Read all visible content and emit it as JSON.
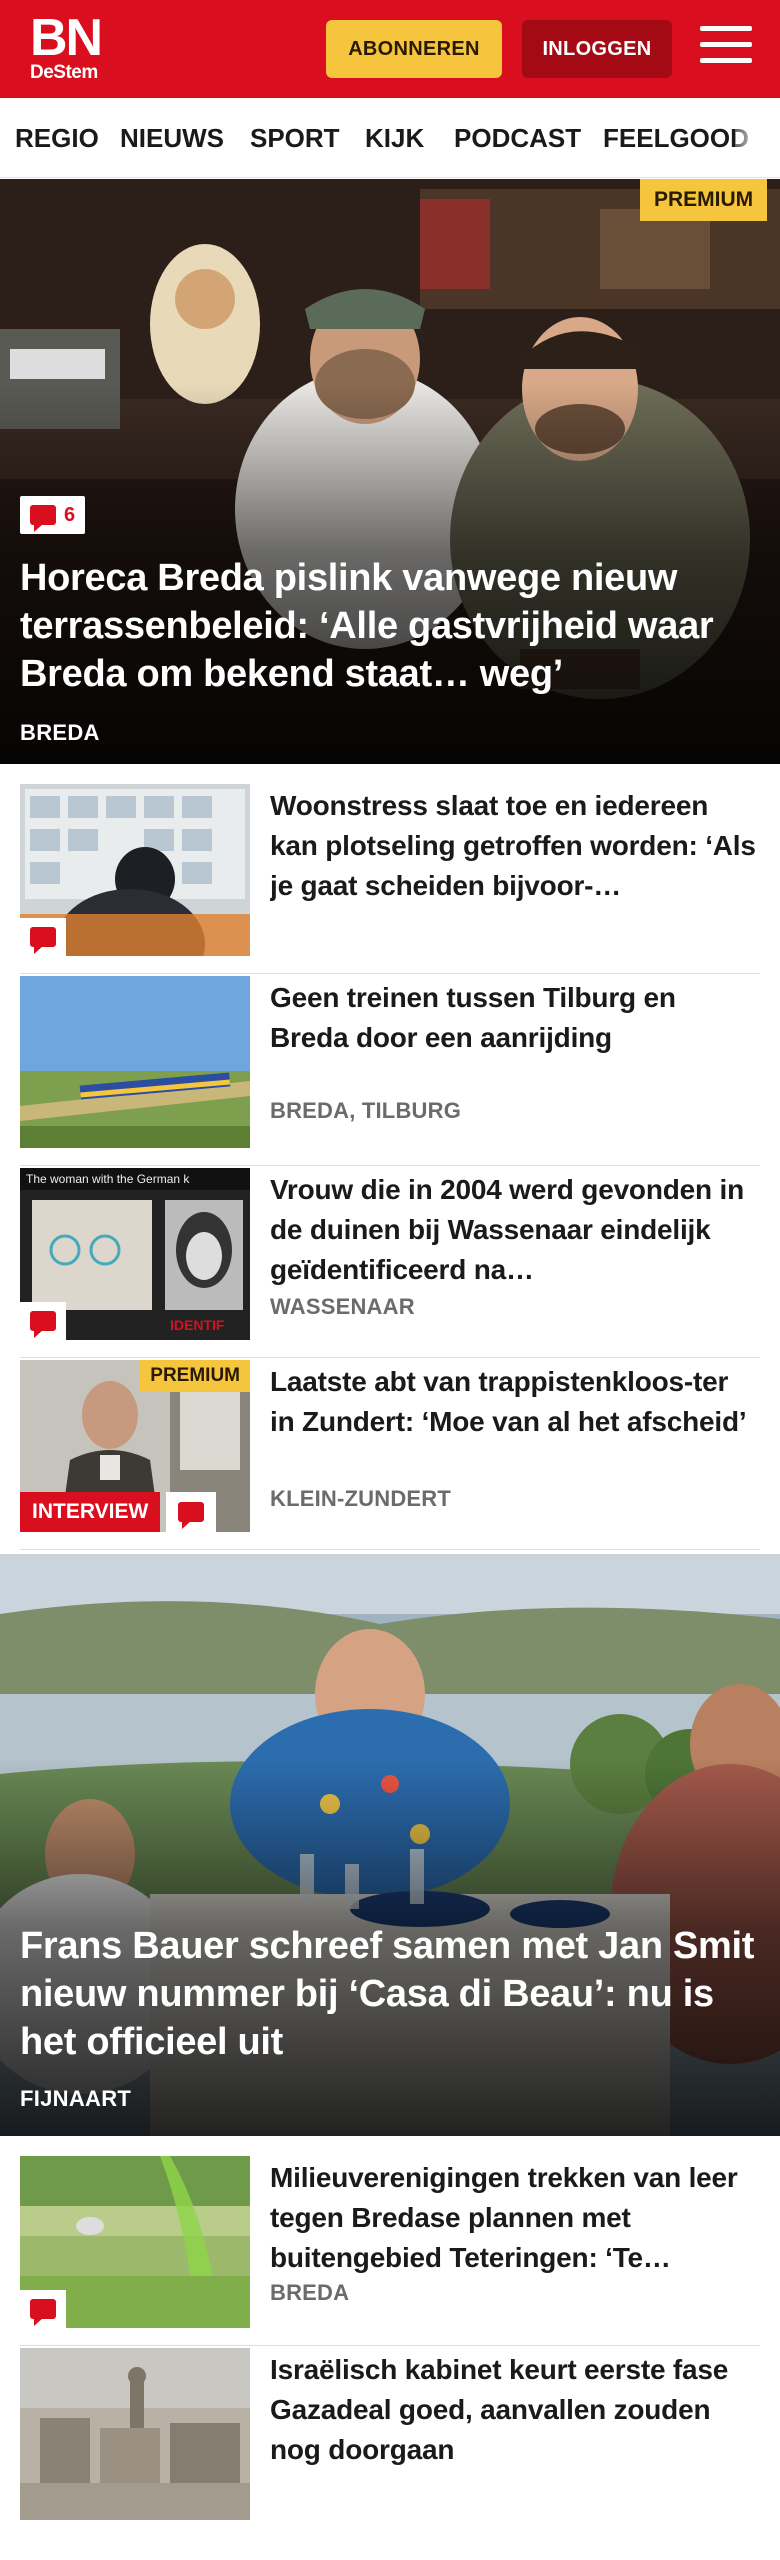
{
  "header": {
    "logo_main": "BN",
    "logo_sub": "DeStem",
    "subscribe_label": "ABONNEREN",
    "login_label": "INLOGGEN",
    "colors": {
      "brand": "#d90f1f",
      "accent": "#f5c53d",
      "login": "#a30a14"
    }
  },
  "nav": {
    "items": [
      {
        "label": "REGIO"
      },
      {
        "label": "NIEUWS"
      },
      {
        "label": "SPORT"
      },
      {
        "label": "KIJK"
      },
      {
        "label": "PODCAST"
      },
      {
        "label": "FEELGOOD"
      }
    ]
  },
  "hero1": {
    "badge": "PREMIUM",
    "comment_count": "6",
    "title": "Horeca Breda pislink vanwege nieuw terrassenbeleid: ‘Alle gastvrijheid waar Breda om bekend staat… weg’",
    "location": "BREDA",
    "icon": "comment-icon"
  },
  "articles": [
    {
      "title": "Woonstress slaat toe en iedereen kan plotseling getroffen worden: ‘Als je gaat scheiden bijvoor-…",
      "location": "",
      "has_comments": true
    },
    {
      "title": "Geen treinen tussen Tilburg en Breda door een aanrijding",
      "location": "BREDA, TILBURG",
      "has_comments": false
    },
    {
      "title": "Vrouw die in 2004 werd gevonden in de duinen bij Wassenaar eindelijk geïdentificeerd na…",
      "location": "WASSENAAR",
      "has_comments": true,
      "thumb_caption": "The woman with the German k",
      "thumb_label": "IDENTIF"
    },
    {
      "title": "Laatste abt van trappistenkloos-ter in Zundert: ‘Moe van al het afscheid’",
      "location": "KLEIN-ZUNDERT",
      "badge": "PREMIUM",
      "tag": "INTERVIEW",
      "has_comments": true
    }
  ],
  "hero2": {
    "title": "Frans Bauer schreef samen met Jan Smit nieuw nummer bij ‘Casa di Beau’: nu is het officieel uit",
    "location": "FIJNAART"
  },
  "articles2": [
    {
      "title": "Milieuverenigingen trekken van leer tegen Bredase plannen met buitengebied Teteringen: ‘Te…",
      "location": "BREDA",
      "has_comments": true
    },
    {
      "title": "Israëlisch kabinet keurt eerste fase Gazadeal goed, aanvallen zouden nog doorgaan",
      "location": "",
      "has_comments": false
    }
  ]
}
